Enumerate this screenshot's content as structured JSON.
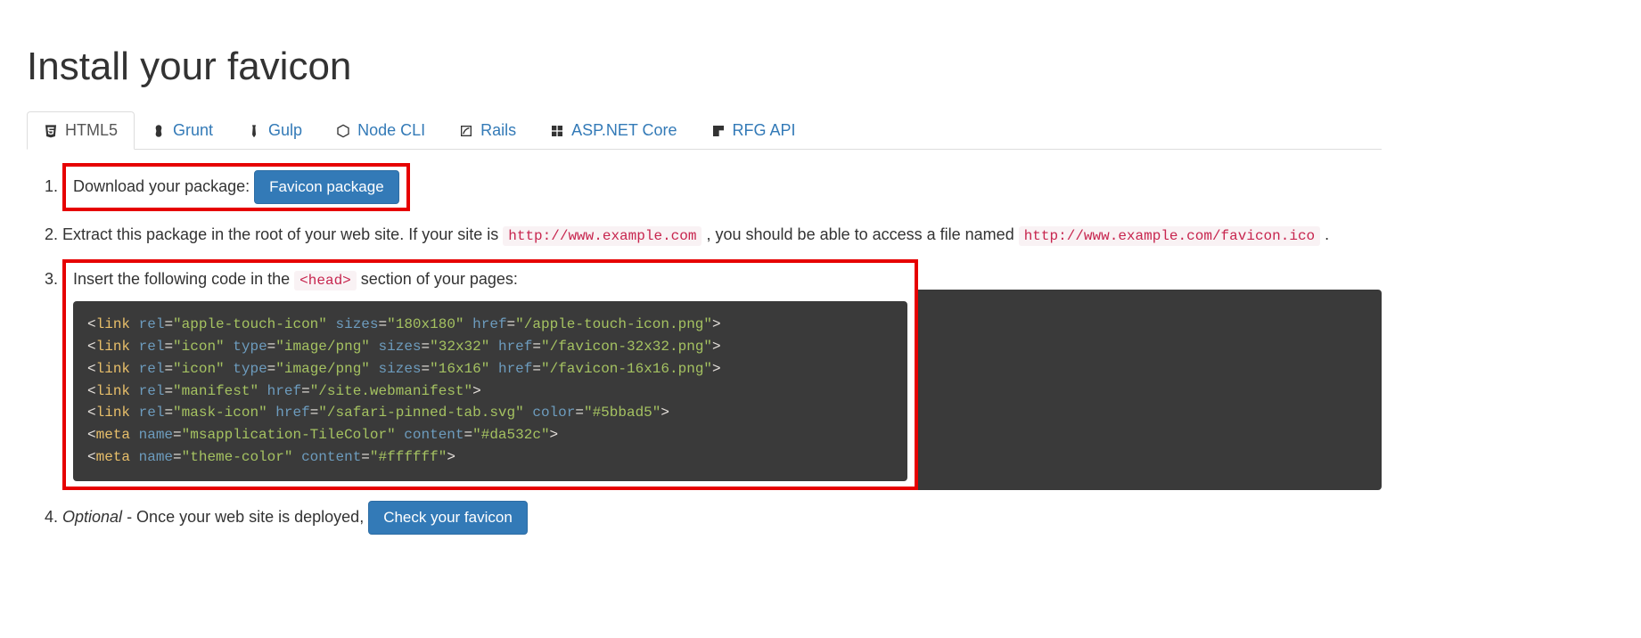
{
  "heading": "Install your favicon",
  "tabs": [
    {
      "label": "HTML5"
    },
    {
      "label": "Grunt"
    },
    {
      "label": "Gulp"
    },
    {
      "label": "Node CLI"
    },
    {
      "label": "Rails"
    },
    {
      "label": "ASP.NET Core"
    },
    {
      "label": "RFG API"
    }
  ],
  "step1_text": "Download your package:",
  "step1_button": "Favicon package",
  "step2_pre": "Extract this package in the root of your web site. If your site is ",
  "step2_url1": "http://www.example.com",
  "step2_mid": " , you should be able to access a file named ",
  "step2_url2": "http://www.example.com/favicon.ico",
  "step2_post": " .",
  "step3_pre": "Insert the following code in the ",
  "step3_code": "<head>",
  "step3_post": " section of your pages:",
  "code_lines": [
    [
      [
        "<",
        "br"
      ],
      [
        "link",
        "tag"
      ],
      [
        " ",
        "br"
      ],
      [
        "rel",
        "attr"
      ],
      [
        "=",
        "eq"
      ],
      [
        "\"apple-touch-icon\"",
        "val"
      ],
      [
        " ",
        "br"
      ],
      [
        "sizes",
        "attr"
      ],
      [
        "=",
        "eq"
      ],
      [
        "\"180x180\"",
        "val"
      ],
      [
        " ",
        "br"
      ],
      [
        "href",
        "attr"
      ],
      [
        "=",
        "eq"
      ],
      [
        "\"/apple-touch-icon.png\"",
        "val"
      ],
      [
        ">",
        "br"
      ]
    ],
    [
      [
        "<",
        "br"
      ],
      [
        "link",
        "tag"
      ],
      [
        " ",
        "br"
      ],
      [
        "rel",
        "attr"
      ],
      [
        "=",
        "eq"
      ],
      [
        "\"icon\"",
        "val"
      ],
      [
        " ",
        "br"
      ],
      [
        "type",
        "attr"
      ],
      [
        "=",
        "eq"
      ],
      [
        "\"image/png\"",
        "val"
      ],
      [
        " ",
        "br"
      ],
      [
        "sizes",
        "attr"
      ],
      [
        "=",
        "eq"
      ],
      [
        "\"32x32\"",
        "val"
      ],
      [
        " ",
        "br"
      ],
      [
        "href",
        "attr"
      ],
      [
        "=",
        "eq"
      ],
      [
        "\"/favicon-32x32.png\"",
        "val"
      ],
      [
        ">",
        "br"
      ]
    ],
    [
      [
        "<",
        "br"
      ],
      [
        "link",
        "tag"
      ],
      [
        " ",
        "br"
      ],
      [
        "rel",
        "attr"
      ],
      [
        "=",
        "eq"
      ],
      [
        "\"icon\"",
        "val"
      ],
      [
        " ",
        "br"
      ],
      [
        "type",
        "attr"
      ],
      [
        "=",
        "eq"
      ],
      [
        "\"image/png\"",
        "val"
      ],
      [
        " ",
        "br"
      ],
      [
        "sizes",
        "attr"
      ],
      [
        "=",
        "eq"
      ],
      [
        "\"16x16\"",
        "val"
      ],
      [
        " ",
        "br"
      ],
      [
        "href",
        "attr"
      ],
      [
        "=",
        "eq"
      ],
      [
        "\"/favicon-16x16.png\"",
        "val"
      ],
      [
        ">",
        "br"
      ]
    ],
    [
      [
        "<",
        "br"
      ],
      [
        "link",
        "tag"
      ],
      [
        " ",
        "br"
      ],
      [
        "rel",
        "attr"
      ],
      [
        "=",
        "eq"
      ],
      [
        "\"manifest\"",
        "val"
      ],
      [
        " ",
        "br"
      ],
      [
        "href",
        "attr"
      ],
      [
        "=",
        "eq"
      ],
      [
        "\"/site.webmanifest\"",
        "val"
      ],
      [
        ">",
        "br"
      ]
    ],
    [
      [
        "<",
        "br"
      ],
      [
        "link",
        "tag"
      ],
      [
        " ",
        "br"
      ],
      [
        "rel",
        "attr"
      ],
      [
        "=",
        "eq"
      ],
      [
        "\"mask-icon\"",
        "val"
      ],
      [
        " ",
        "br"
      ],
      [
        "href",
        "attr"
      ],
      [
        "=",
        "eq"
      ],
      [
        "\"/safari-pinned-tab.svg\"",
        "val"
      ],
      [
        " ",
        "br"
      ],
      [
        "color",
        "attr"
      ],
      [
        "=",
        "eq"
      ],
      [
        "\"#5bbad5\"",
        "val"
      ],
      [
        ">",
        "br"
      ]
    ],
    [
      [
        "<",
        "br"
      ],
      [
        "meta",
        "tag"
      ],
      [
        " ",
        "br"
      ],
      [
        "name",
        "attr"
      ],
      [
        "=",
        "eq"
      ],
      [
        "\"msapplication-TileColor\"",
        "val"
      ],
      [
        " ",
        "br"
      ],
      [
        "content",
        "attr"
      ],
      [
        "=",
        "eq"
      ],
      [
        "\"#da532c\"",
        "val"
      ],
      [
        ">",
        "br"
      ]
    ],
    [
      [
        "<",
        "br"
      ],
      [
        "meta",
        "tag"
      ],
      [
        " ",
        "br"
      ],
      [
        "name",
        "attr"
      ],
      [
        "=",
        "eq"
      ],
      [
        "\"theme-color\"",
        "val"
      ],
      [
        " ",
        "br"
      ],
      [
        "content",
        "attr"
      ],
      [
        "=",
        "eq"
      ],
      [
        "\"#ffffff\"",
        "val"
      ],
      [
        ">",
        "br"
      ]
    ]
  ],
  "step4_em": "Optional",
  "step4_text": " - Once your web site is deployed, ",
  "step4_button": "Check your favicon"
}
